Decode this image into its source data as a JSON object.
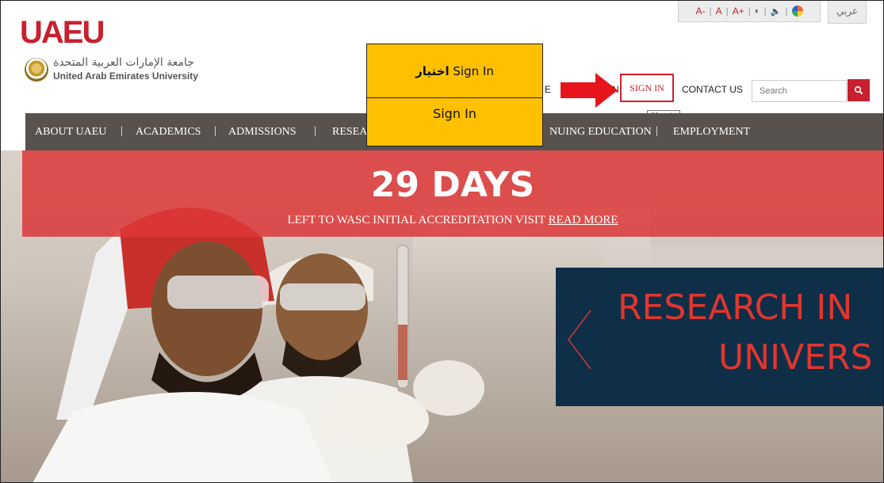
{
  "header": {
    "logo_text": "UAEU",
    "university_name_ar": "جامعة الإمارات العربية المتحدة",
    "university_name_en": "United Arab Emirates University"
  },
  "accessibility": {
    "font_smaller": "A-",
    "font_normal": "A",
    "font_larger": "A+",
    "separator": "|",
    "contrast_icon": "contrast-icon",
    "audio_icon": "speaker-icon",
    "color_icon": "color-wheel-icon"
  },
  "language_toggle": "عربي",
  "top_links": {
    "partial_left": "E",
    "partial_mid": "N",
    "sign_in": "SIGN IN",
    "contact_us": "CONTACT US"
  },
  "search": {
    "placeholder": "Search",
    "button_icon": "search-icon"
  },
  "tooltip": "Sign In",
  "callout": {
    "row1_ar": "اختيار",
    "row1_en": "Sign In",
    "row2": "Sign In"
  },
  "main_nav": {
    "items": [
      "ABOUT UAEU",
      "ACADEMICS",
      "ADMISSIONS",
      "RESEA",
      "NUING EDUCATION",
      "EMPLOYMENT"
    ],
    "separator": "|"
  },
  "countdown": {
    "days": "29 DAYS",
    "message": "LEFT TO WASC INITIAL ACCREDITATION VISIT",
    "read_more": "READ MORE"
  },
  "slider": {
    "line1": "RESEARCH IN",
    "line2": "UNIVERS",
    "prev_icon": "chevron-left-icon"
  },
  "colors": {
    "brand_red": "#c8202e",
    "nav_bg": "#57524e",
    "callout_yellow": "#ffc000",
    "slide_navy": "#0f2e48"
  }
}
